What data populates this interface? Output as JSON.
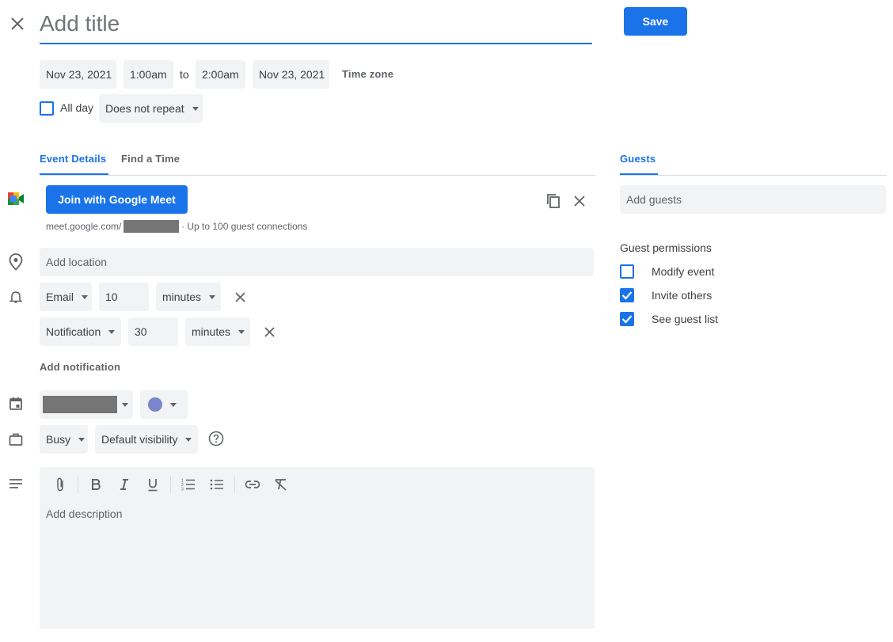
{
  "header": {
    "title_placeholder": "Add title",
    "save_label": "Save"
  },
  "datetime": {
    "start_date": "Nov 23, 2021",
    "start_time": "1:00am",
    "to_label": "to",
    "end_time": "2:00am",
    "end_date": "Nov 23, 2021",
    "timezone_label": "Time zone"
  },
  "options": {
    "all_day_label": "All day",
    "repeat_value": "Does not repeat"
  },
  "tabs": [
    {
      "label": "Event Details",
      "active": true
    },
    {
      "label": "Find a Time",
      "active": false
    }
  ],
  "meet": {
    "join_label": "Join with Google Meet",
    "link_prefix": "meet.google.com/",
    "link_suffix": "· Up to 100 guest connections"
  },
  "location": {
    "placeholder": "Add location"
  },
  "notifications": [
    {
      "type": "Email",
      "amount": "10",
      "unit": "minutes"
    },
    {
      "type": "Notification",
      "amount": "30",
      "unit": "minutes"
    }
  ],
  "add_notification_label": "Add notification",
  "calendar": {
    "color": "#7986cb"
  },
  "availability": {
    "status": "Busy",
    "visibility": "Default visibility"
  },
  "description": {
    "placeholder": "Add description",
    "toolbar_icons": [
      "attach-icon",
      "bold-icon",
      "italic-icon",
      "underline-icon",
      "numbered-list-icon",
      "bulleted-list-icon",
      "link-icon",
      "clear-format-icon"
    ]
  },
  "guests": {
    "tab_label": "Guests",
    "add_placeholder": "Add guests",
    "permissions_title": "Guest permissions",
    "permissions": [
      {
        "label": "Modify event",
        "checked": false
      },
      {
        "label": "Invite others",
        "checked": true
      },
      {
        "label": "See guest list",
        "checked": true
      }
    ]
  },
  "colors": {
    "accent": "#1a73e8",
    "chip_bg": "#f1f3f4"
  }
}
